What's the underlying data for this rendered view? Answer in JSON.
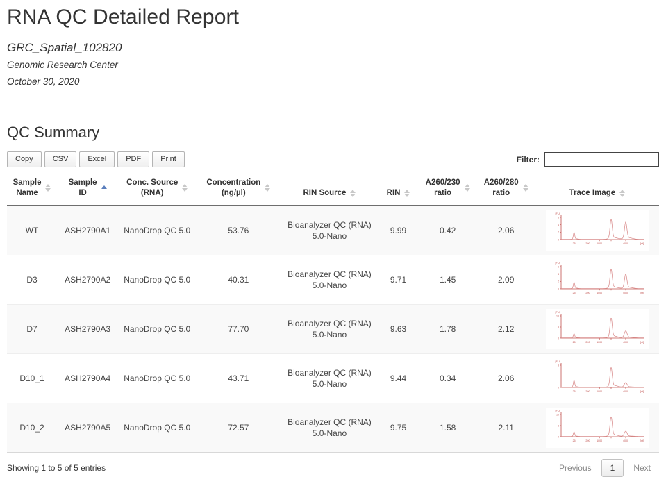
{
  "report": {
    "title": "RNA QC Detailed Report",
    "project": "GRC_Spatial_102820",
    "organization": "Genomic Research Center",
    "date": "October 30, 2020"
  },
  "section": {
    "title": "QC Summary"
  },
  "toolbar": {
    "buttons": [
      {
        "label": "Copy",
        "name": "copy-button"
      },
      {
        "label": "CSV",
        "name": "csv-button"
      },
      {
        "label": "Excel",
        "name": "excel-button"
      },
      {
        "label": "PDF",
        "name": "pdf-button"
      },
      {
        "label": "Print",
        "name": "print-button"
      }
    ],
    "filter_label": "Filter:",
    "filter_value": "",
    "filter_placeholder": ""
  },
  "table": {
    "columns": [
      {
        "label": "Sample Name",
        "line1": "Sample",
        "line2": "Name",
        "sort": "none"
      },
      {
        "label": "Sample ID",
        "line1": "Sample",
        "line2": "ID",
        "sort": "asc"
      },
      {
        "label": "Conc. Source (RNA)",
        "line1": "Conc. Source",
        "line2": "(RNA)",
        "sort": "none"
      },
      {
        "label": "Concentration (ng/µl)",
        "line1": "Concentration",
        "line2": "(ng/µl)",
        "sort": "none"
      },
      {
        "label": "RIN Source",
        "line1": "RIN Source",
        "line2": "",
        "sort": "none"
      },
      {
        "label": "RIN",
        "line1": "RIN",
        "line2": "",
        "sort": "none"
      },
      {
        "label": "A260/230 ratio",
        "line1": "A260/230",
        "line2": "ratio",
        "sort": "none"
      },
      {
        "label": "A260/280 ratio",
        "line1": "A260/280",
        "line2": "ratio",
        "sort": "none"
      },
      {
        "label": "Trace Image",
        "line1": "Trace Image",
        "line2": "",
        "sort": "none"
      }
    ],
    "rows": [
      {
        "sample_name": "WT",
        "sample_id": "ASH2790A1",
        "conc_source": "NanoDrop QC 5.0",
        "concentration": "53.76",
        "rin_source_line1": "Bioanalyzer QC (RNA)",
        "rin_source_line2": "5.0-Nano",
        "rin": "9.99",
        "a260_230": "0.42",
        "a260_230_flag": "low",
        "a260_280": "2.06",
        "trace": {
          "y_label": "[FU]",
          "x_label": "[nt]",
          "y_ticks": [
            "6",
            "4",
            "2",
            "0"
          ],
          "x_ticks": [
            "25",
            "200",
            "1000",
            "4000"
          ],
          "peaks": [
            {
              "x": 0.155,
              "h": 0.33,
              "w": 0.008
            },
            {
              "x": 0.6,
              "h": 0.95,
              "w": 0.013
            },
            {
              "x": 0.775,
              "h": 0.82,
              "w": 0.014
            }
          ]
        }
      },
      {
        "sample_name": "D3",
        "sample_id": "ASH2790A2",
        "conc_source": "NanoDrop QC 5.0",
        "concentration": "40.31",
        "rin_source_line1": "Bioanalyzer QC (RNA)",
        "rin_source_line2": "5.0-Nano",
        "rin": "9.71",
        "a260_230": "1.45",
        "a260_230_flag": "low",
        "a260_280": "2.09",
        "trace": {
          "y_label": "[FU]",
          "x_label": "[nt]",
          "y_ticks": [
            "6",
            "4",
            "2",
            "0"
          ],
          "x_ticks": [
            "25",
            "200",
            "1000",
            "4000"
          ],
          "peaks": [
            {
              "x": 0.155,
              "h": 0.3,
              "w": 0.008
            },
            {
              "x": 0.6,
              "h": 0.92,
              "w": 0.013
            },
            {
              "x": 0.775,
              "h": 0.7,
              "w": 0.014
            }
          ]
        }
      },
      {
        "sample_name": "D7",
        "sample_id": "ASH2790A3",
        "conc_source": "NanoDrop QC 5.0",
        "concentration": "77.70",
        "rin_source_line1": "Bioanalyzer QC (RNA)",
        "rin_source_line2": "5.0-Nano",
        "rin": "9.63",
        "a260_230": "1.78",
        "a260_230_flag": "low",
        "a260_280": "2.12",
        "trace": {
          "y_label": "[FU]",
          "x_label": "[nt]",
          "y_ticks": [
            "10",
            "5",
            "0"
          ],
          "x_ticks": [
            "25",
            "200",
            "1000",
            "4000"
          ],
          "peaks": [
            {
              "x": 0.155,
              "h": 0.2,
              "w": 0.008
            },
            {
              "x": 0.6,
              "h": 0.95,
              "w": 0.013
            },
            {
              "x": 0.775,
              "h": 0.33,
              "w": 0.016
            }
          ]
        }
      },
      {
        "sample_name": "D10_1",
        "sample_id": "ASH2790A4",
        "conc_source": "NanoDrop QC 5.0",
        "concentration": "43.71",
        "rin_source_line1": "Bioanalyzer QC (RNA)",
        "rin_source_line2": "5.0-Nano",
        "rin": "9.44",
        "a260_230": "0.34",
        "a260_230_flag": "low",
        "a260_280": "2.06",
        "trace": {
          "y_label": "[FU]",
          "x_label": "[nt]",
          "y_ticks": [
            "5",
            "0"
          ],
          "x_ticks": [
            "25",
            "200",
            "1000",
            "4000"
          ],
          "peaks": [
            {
              "x": 0.155,
              "h": 0.32,
              "w": 0.008
            },
            {
              "x": 0.6,
              "h": 0.93,
              "w": 0.013
            },
            {
              "x": 0.775,
              "h": 0.22,
              "w": 0.016
            }
          ]
        }
      },
      {
        "sample_name": "D10_2",
        "sample_id": "ASH2790A5",
        "conc_source": "NanoDrop QC 5.0",
        "concentration": "72.57",
        "rin_source_line1": "Bioanalyzer QC (RNA)",
        "rin_source_line2": "5.0-Nano",
        "rin": "9.75",
        "a260_230": "1.58",
        "a260_230_flag": "low",
        "a260_280": "2.11",
        "trace": {
          "y_label": "[FU]",
          "x_label": "[nt]",
          "y_ticks": [
            "10",
            "5",
            "0"
          ],
          "x_ticks": [
            "25",
            "200",
            "1000",
            "4000"
          ],
          "peaks": [
            {
              "x": 0.155,
              "h": 0.22,
              "w": 0.008
            },
            {
              "x": 0.6,
              "h": 0.95,
              "w": 0.013
            },
            {
              "x": 0.775,
              "h": 0.25,
              "w": 0.016
            }
          ]
        }
      }
    ]
  },
  "footer": {
    "info": "Showing 1 to 5 of 5 entries",
    "previous_label": "Previous",
    "page_label": "1",
    "next_label": "Next"
  },
  "colors": {
    "trace_line": "#d98b8b",
    "trace_axis": "#c0504d",
    "ratio_bad": "#d9534f",
    "sort_active": "#5b7fbd"
  }
}
